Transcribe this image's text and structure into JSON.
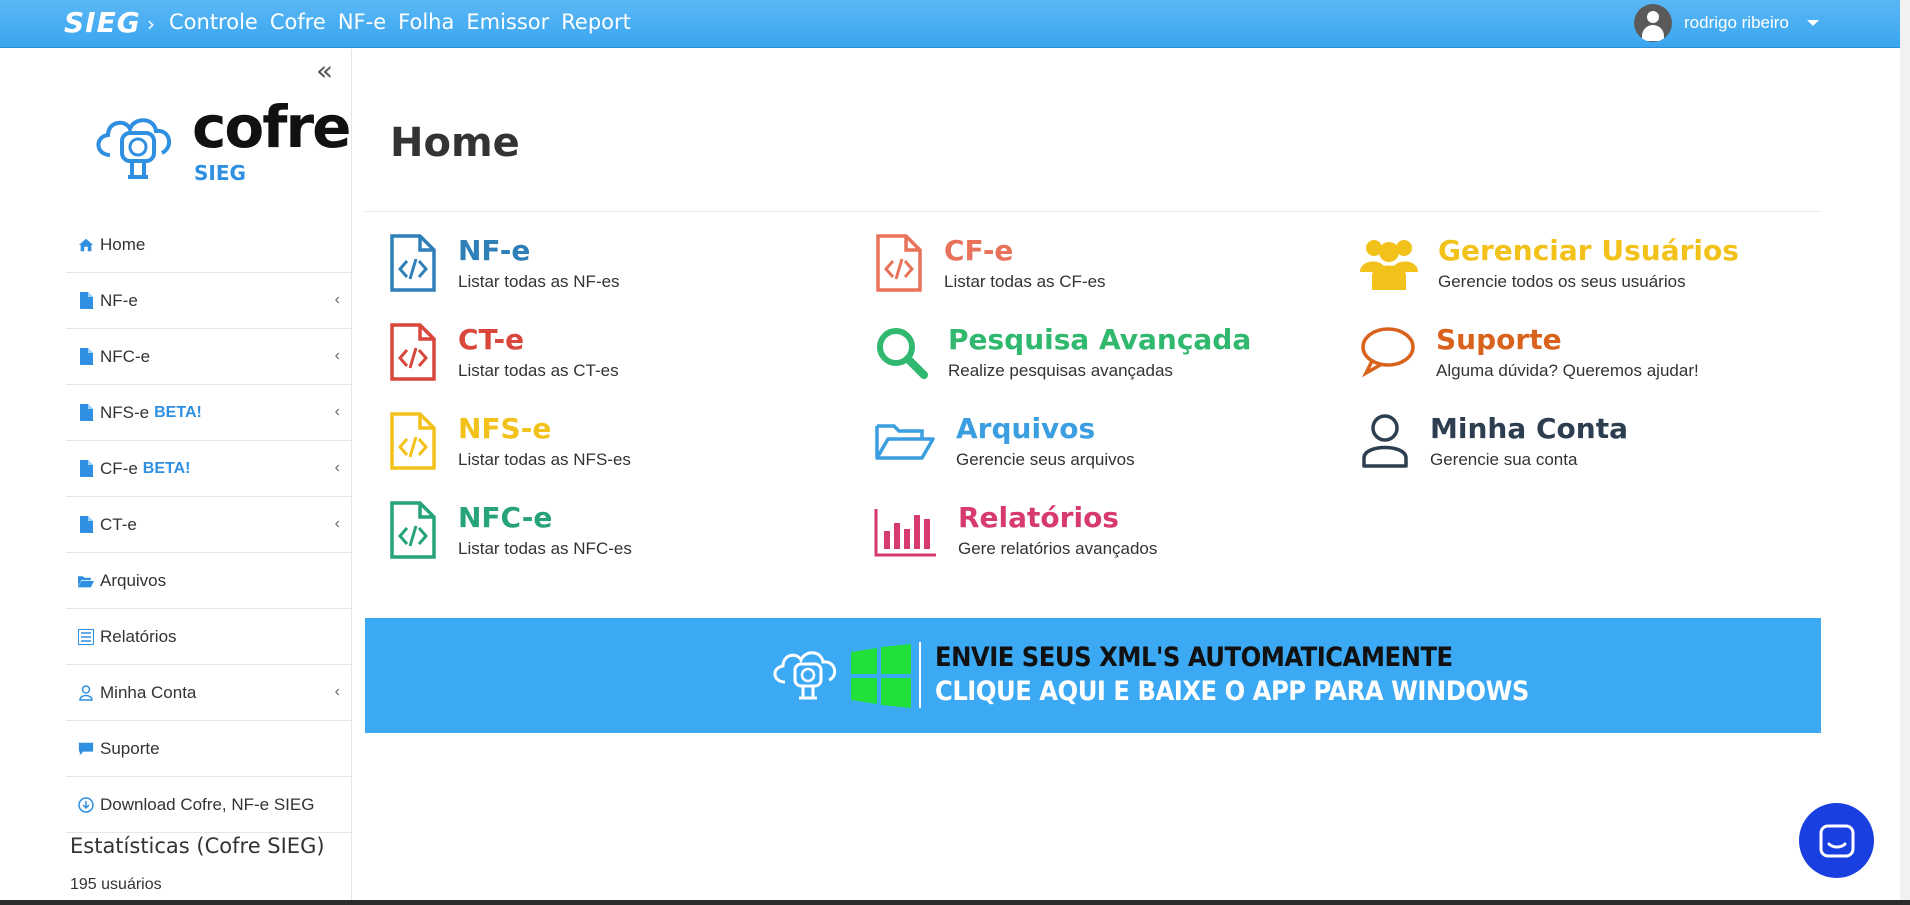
{
  "topbar": {
    "brand": "SIEG",
    "separator": "›",
    "nav": [
      "Controle",
      "Cofre",
      "NF-e",
      "Folha",
      "Emissor",
      "Report"
    ],
    "user_name": "rodrigo ribeiro"
  },
  "sidebar": {
    "collapse_glyph": "«",
    "logo": {
      "word": "cofre",
      "sub": "SIEG"
    },
    "items": [
      {
        "label": "Home",
        "icon": "home-icon",
        "beta": "",
        "has_children": false
      },
      {
        "label": "NF-e",
        "icon": "file-icon",
        "beta": "",
        "has_children": true
      },
      {
        "label": "NFC-e",
        "icon": "file-icon",
        "beta": "",
        "has_children": true
      },
      {
        "label": "NFS-e",
        "icon": "file-icon",
        "beta": "BETA!",
        "has_children": true
      },
      {
        "label": "CF-e",
        "icon": "file-icon",
        "beta": "BETA!",
        "has_children": true
      },
      {
        "label": "CT-e",
        "icon": "file-icon",
        "beta": "",
        "has_children": true
      },
      {
        "label": "Arquivos",
        "icon": "folder-open-icon",
        "beta": "",
        "has_children": false
      },
      {
        "label": "Relatórios",
        "icon": "list-icon",
        "beta": "",
        "has_children": false
      },
      {
        "label": "Minha Conta",
        "icon": "user-icon",
        "beta": "",
        "has_children": true
      },
      {
        "label": "Suporte",
        "icon": "comment-icon",
        "beta": "",
        "has_children": false
      },
      {
        "label": "Download Cofre, NF-e SIEG",
        "icon": "download-icon",
        "beta": "",
        "has_children": false
      }
    ],
    "stats_title": "Estatísticas (Cofre SIEG)",
    "stats_users": "195 usuários"
  },
  "main": {
    "title": "Home",
    "tiles": [
      {
        "title": "NF-e",
        "desc": "Listar todas as NF-es",
        "icon": "file-code-icon",
        "color": "#2f7fb8"
      },
      {
        "title": "CF-e",
        "desc": "Listar todas as CF-es",
        "icon": "file-code-icon",
        "color": "#e8735a"
      },
      {
        "title": "Gerenciar Usuários",
        "desc": "Gerencie todos os seus usuários",
        "icon": "users-icon",
        "color": "#f2c21b"
      },
      {
        "title": "CT-e",
        "desc": "Listar todas as CT-es",
        "icon": "file-code-icon",
        "color": "#d9463c"
      },
      {
        "title": "Pesquisa Avançada",
        "desc": "Realize pesquisas avançadas",
        "icon": "search-icon",
        "color": "#2fb86e"
      },
      {
        "title": "Suporte",
        "desc": "Alguma dúvida? Queremos ajudar!",
        "icon": "comment-icon",
        "color": "#d9621c"
      },
      {
        "title": "NFS-e",
        "desc": "Listar todas as NFS-es",
        "icon": "file-code-icon",
        "color": "#f2c21b"
      },
      {
        "title": "Arquivos",
        "desc": "Gerencie seus arquivos",
        "icon": "folder-open-icon",
        "color": "#3a9ee0"
      },
      {
        "title": "Minha Conta",
        "desc": "Gerencie sua conta",
        "icon": "user-icon",
        "color": "#2c3e50"
      },
      {
        "title": "NFC-e",
        "desc": "Listar todas as NFC-es",
        "icon": "file-code-icon",
        "color": "#26a37b"
      },
      {
        "title": "Relatórios",
        "desc": "Gere relatórios avançados",
        "icon": "bar-chart-icon",
        "color": "#d63a6e"
      }
    ],
    "banner": {
      "line1": "ENVIE SEUS XML'S AUTOMATICAMENTE",
      "line2": "CLIQUE AQUI E BAIXE O APP PARA WINDOWS"
    }
  },
  "colors": {
    "topbar": "#3aa6f0",
    "banner": "#3ba9f3",
    "accent": "#2f8fe0",
    "chat": "#1a3fe0"
  }
}
